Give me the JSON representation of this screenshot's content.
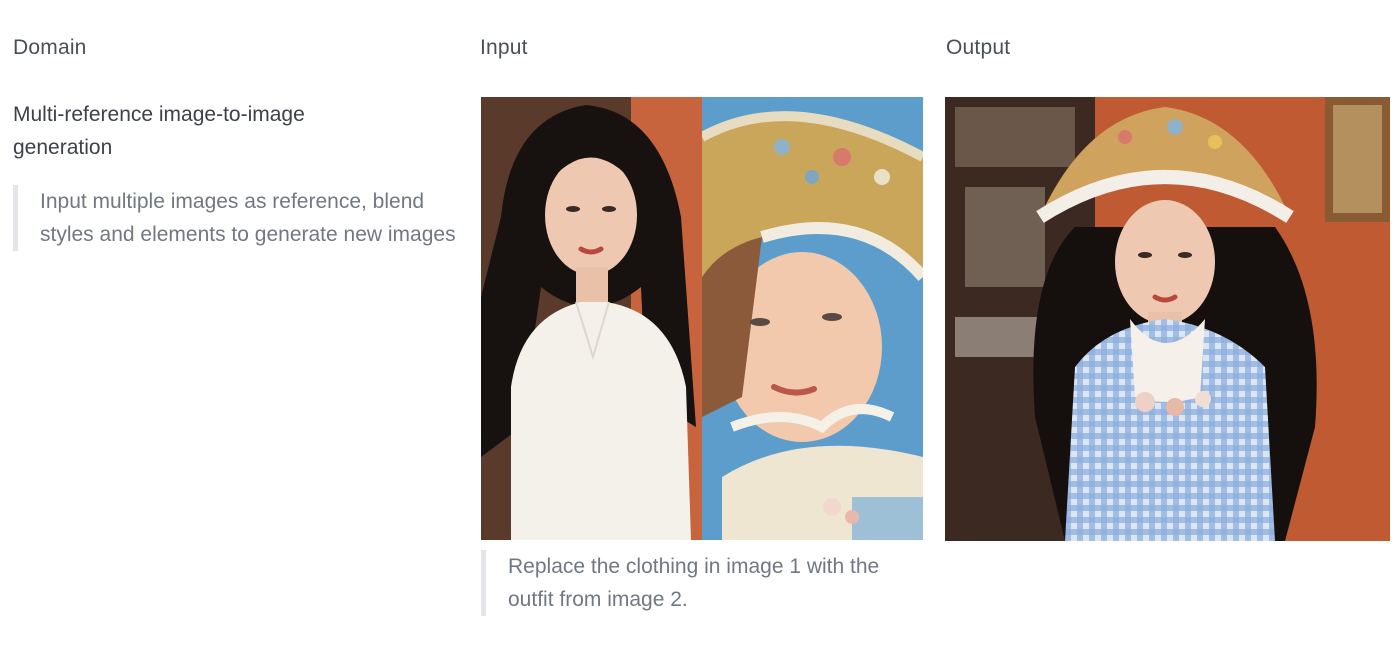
{
  "headers": {
    "domain": "Domain",
    "input": "Input",
    "output": "Output"
  },
  "domain": {
    "title": "Multi-reference image-to-image generation",
    "description": "Input multiple images as reference, blend styles and elements to generate new images"
  },
  "input": {
    "caption": "Replace the clothing in image 1 with the outfit from image 2.",
    "images": [
      {
        "name": "image 1",
        "subject": "woman-white-dress-portrait"
      },
      {
        "name": "image 2",
        "subject": "girl-straw-bonnet-portrait"
      }
    ]
  },
  "output": {
    "image": {
      "subject": "woman-straw-hat-gingham-dress-portrait"
    }
  },
  "colors": {
    "header_text": "#4a4f57",
    "body_text": "#3d424a",
    "quote_text": "#727882",
    "quote_border": "#e3e5e8",
    "background": "#ffffff"
  }
}
